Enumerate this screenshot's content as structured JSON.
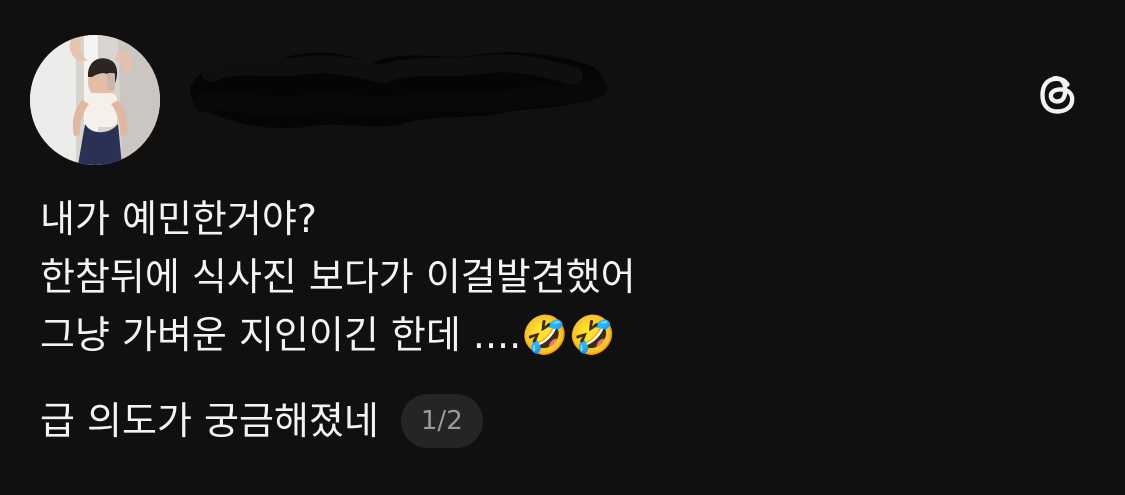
{
  "post": {
    "lines": [
      "내가 예민한거야?",
      "한참뒤에 식사진 보다가 이걸발견했어",
      "그냥 가벼운 지인이긴 한데 ....🤣🤣",
      "급 의도가 궁금해졌네"
    ],
    "page_indicator": "1/2"
  },
  "icons": {
    "avatar": "profile-photo",
    "logo": "threads-icon"
  },
  "colors": {
    "background": "#101010",
    "text": "#f3f3f3",
    "pill_background": "#252525",
    "pill_text": "#9a9a9a"
  }
}
